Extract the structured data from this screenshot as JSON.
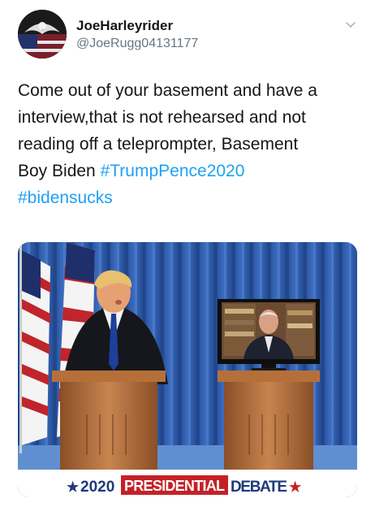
{
  "user": {
    "display_name": "JoeHarleyrider",
    "handle": "@JoeRugg04131177",
    "avatar_icon": "eagle-flag-avatar"
  },
  "header": {
    "menu_icon": "chevron-down-icon"
  },
  "tweet": {
    "text_lines": [
      "Come out of your basement and have a",
      "interview,that is not rehearsed and not",
      "reading off a teleprompter, Basement",
      "Boy Biden "
    ],
    "hashtag_1": "#TrumpPence2020",
    "hashtag_2": "#bidensucks"
  },
  "media": {
    "banner_year": "2020",
    "banner_word1": "PRESIDENTIAL",
    "banner_word2": "DEBATE"
  },
  "colors": {
    "link": "#1da1f2",
    "handle": "#657786",
    "curtain": "#2f5da8",
    "podium": "#b2703f",
    "banner_red": "#c42127",
    "banner_blue": "#1e3a7a"
  }
}
